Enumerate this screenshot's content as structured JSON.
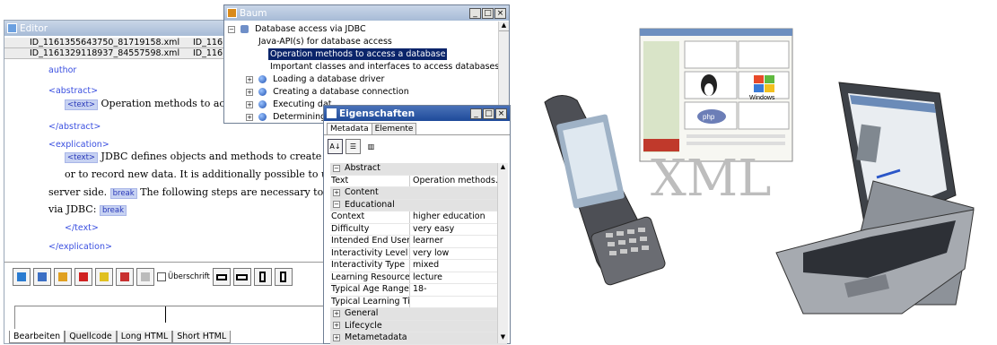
{
  "editor": {
    "title": "Editor",
    "files": [
      {
        "name": "ID_1161355643750_81719158.xml",
        "col": "ID_116"
      },
      {
        "name": "ID_1161329118937_84557598.xml",
        "col": "ID_116"
      }
    ],
    "lines": {
      "author": "author",
      "abstract_open": "<abstract>",
      "text_tag": "<text>",
      "abstract_text": "Operation methods to access",
      "abstract_close": "</abstract>",
      "explication_open": "<explication>",
      "p1": "JDBC defines objects and methods to create connect",
      "p2": "or to record new data. It is additionally possible to update tal",
      "p3a": "server side.",
      "break_tag": "break",
      "p3b": "The following steps are necessary to guara",
      "p4": "via JDBC:",
      "text_close": "</text>",
      "explication_close": "</explication>"
    },
    "toolbar": {
      "checkbox_label": "Überschrift"
    },
    "tabs": [
      "Bearbeiten",
      "Quellcode",
      "Long HTML",
      "Short HTML"
    ]
  },
  "baum": {
    "title": "Baum",
    "items": [
      "Database access via JDBC",
      "Java-API(s) for database access",
      "Operation methods to access a database",
      "Important classes and interfaces to access databases",
      "Loading a database driver",
      "Creating a database connection",
      "Executing dat",
      "Determining q"
    ]
  },
  "props": {
    "title": "Eigenschaften",
    "tabs": [
      "Metadata",
      "Elemente"
    ],
    "rows": [
      {
        "cat": true,
        "k": "Abstract"
      },
      {
        "k": "Text",
        "v": "Operation methods..."
      },
      {
        "cat": true,
        "k": "Content",
        "plus": true
      },
      {
        "cat": true,
        "k": "Educational"
      },
      {
        "k": "Context",
        "v": "higher education"
      },
      {
        "k": "Difficulty",
        "v": "very easy"
      },
      {
        "k": "Intended End User...",
        "v": "learner"
      },
      {
        "k": "Interactivity Level",
        "v": "very low"
      },
      {
        "k": "Interactivity Type",
        "v": "mixed"
      },
      {
        "k": "Learning Resource ...",
        "v": "lecture"
      },
      {
        "k": "Typical Age Range",
        "v": "18-"
      },
      {
        "k": "Typical Learning Time",
        "v": ""
      },
      {
        "cat": true,
        "k": "General",
        "plus": true
      },
      {
        "cat": true,
        "k": "Lifecycle",
        "plus": true
      },
      {
        "cat": true,
        "k": "Metametadata",
        "plus": true
      }
    ]
  },
  "illustration": {
    "caption": "XML",
    "os_labels": [
      "Windows",
      "php"
    ]
  },
  "colors": {
    "active_title": "#1e4a9a",
    "selected_item": "#0a246a",
    "tag_blue": "#3a4fe0"
  }
}
